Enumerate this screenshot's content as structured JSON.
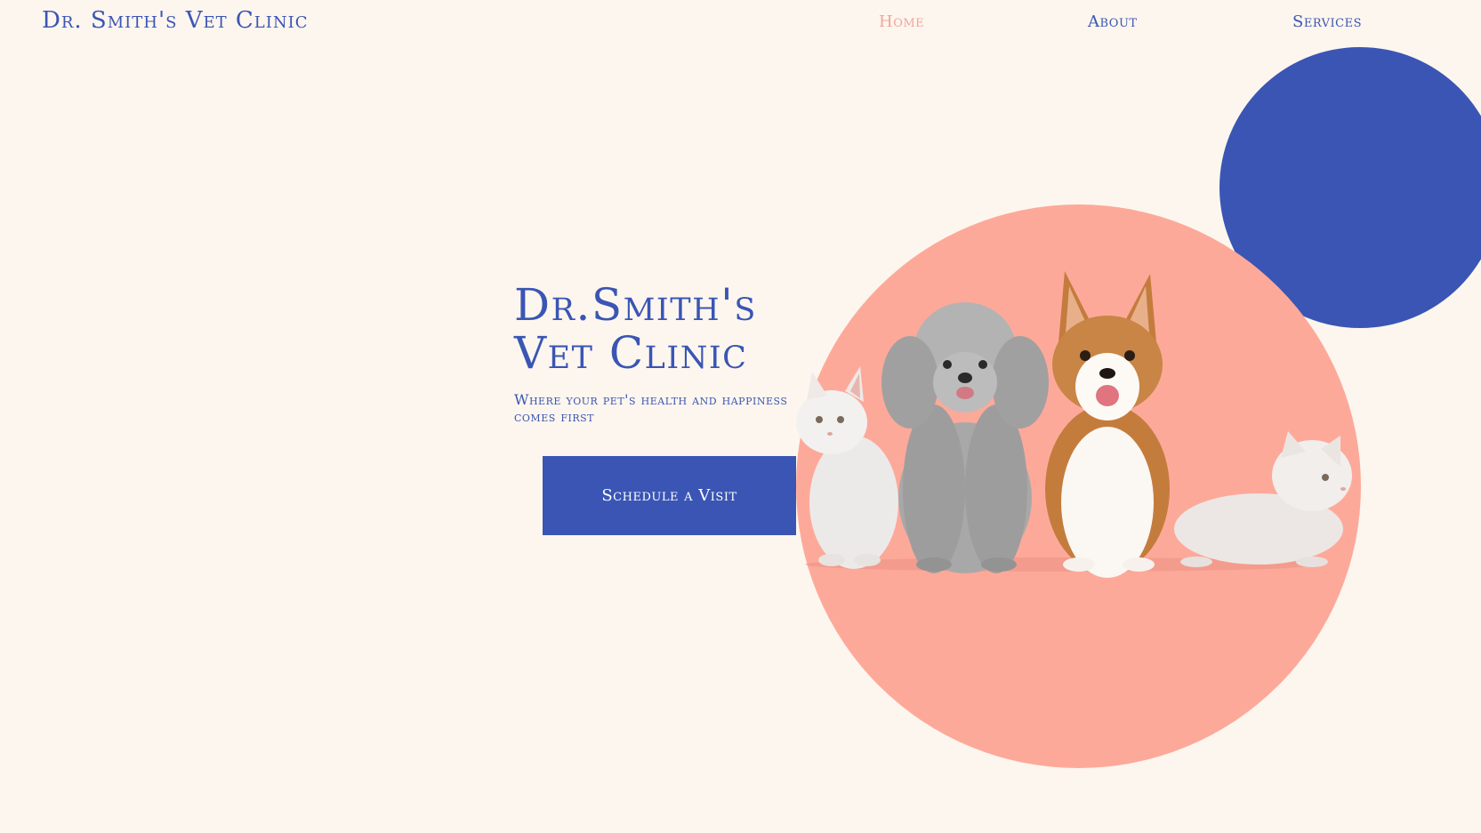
{
  "header": {
    "logo": "Dr. Smith's Vet Clinic",
    "nav": [
      {
        "label": "Home",
        "active": true
      },
      {
        "label": "About",
        "active": false
      },
      {
        "label": "Services",
        "active": false
      }
    ]
  },
  "hero": {
    "title_line1": "Dr.Smith's",
    "title_line2": "Vet Clinic",
    "subtitle": "Where your pet's health and happiness comes first",
    "cta_label": "Schedule a Visit"
  },
  "colors": {
    "background": "#fdf6ee",
    "primary_blue": "#3a55b4",
    "accent_pink": "#fda99a",
    "active_nav": "#f0a699"
  },
  "illustration": {
    "subject": "pets-group-photo"
  }
}
